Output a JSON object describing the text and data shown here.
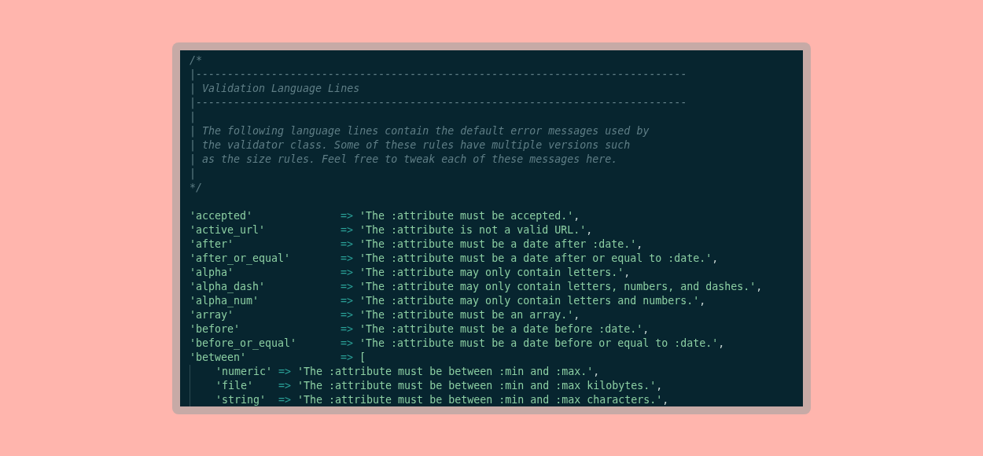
{
  "editor": {
    "lines": [
      {
        "kind": "comment",
        "text": "/*"
      },
      {
        "kind": "comment",
        "text": "|------------------------------------------------------------------------------"
      },
      {
        "kind": "comment",
        "text": "| Validation Language Lines"
      },
      {
        "kind": "comment",
        "text": "|------------------------------------------------------------------------------"
      },
      {
        "kind": "comment",
        "text": "|"
      },
      {
        "kind": "comment",
        "text": "| The following language lines contain the default error messages used by"
      },
      {
        "kind": "comment",
        "text": "| the validator class. Some of these rules have multiple versions such"
      },
      {
        "kind": "comment",
        "text": "| as the size rules. Feel free to tweak each of these messages here."
      },
      {
        "kind": "comment",
        "text": "|"
      },
      {
        "kind": "comment",
        "text": "*/"
      },
      {
        "kind": "blank"
      },
      {
        "kind": "entry",
        "key": "'accepted'",
        "arrow": "=>",
        "value": "'The :attribute must be accepted.'",
        "end": ","
      },
      {
        "kind": "entry",
        "key": "'active_url'",
        "arrow": "=>",
        "value": "'The :attribute is not a valid URL.'",
        "end": ","
      },
      {
        "kind": "entry",
        "key": "'after'",
        "arrow": "=>",
        "value": "'The :attribute must be a date after :date.'",
        "end": ","
      },
      {
        "kind": "entry",
        "key": "'after_or_equal'",
        "arrow": "=>",
        "value": "'The :attribute must be a date after or equal to :date.'",
        "end": ","
      },
      {
        "kind": "entry",
        "key": "'alpha'",
        "arrow": "=>",
        "value": "'The :attribute may only contain letters.'",
        "end": ","
      },
      {
        "kind": "entry",
        "key": "'alpha_dash'",
        "arrow": "=>",
        "value": "'The :attribute may only contain letters, numbers, and dashes.'",
        "end": ","
      },
      {
        "kind": "entry",
        "key": "'alpha_num'",
        "arrow": "=>",
        "value": "'The :attribute may only contain letters and numbers.'",
        "end": ","
      },
      {
        "kind": "entry",
        "key": "'array'",
        "arrow": "=>",
        "value": "'The :attribute must be an array.'",
        "end": ","
      },
      {
        "kind": "entry",
        "key": "'before'",
        "arrow": "=>",
        "value": "'The :attribute must be a date before :date.'",
        "end": ","
      },
      {
        "kind": "entry",
        "key": "'before_or_equal'",
        "arrow": "=>",
        "value": "'The :attribute must be a date before or equal to :date.'",
        "end": ","
      },
      {
        "kind": "entry",
        "key": "'between'",
        "arrow": "=>",
        "value": "["
      },
      {
        "kind": "nested",
        "key": "'numeric'",
        "arrow": "=>",
        "value": "'The :attribute must be between :min and :max.'",
        "end": ","
      },
      {
        "kind": "nested",
        "key": "'file'",
        "arrow": "=>",
        "value": "'The :attribute must be between :min and :max kilobytes.'",
        "end": ","
      },
      {
        "kind": "nested",
        "key": "'string'",
        "arrow": "=>",
        "value": "'The :attribute must be between :min and :max characters.'",
        "end": ","
      }
    ]
  }
}
